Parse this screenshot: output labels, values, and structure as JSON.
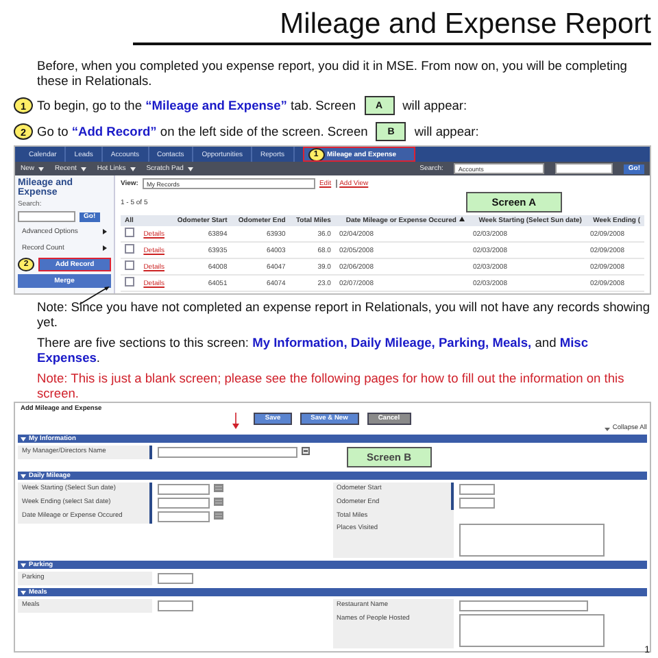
{
  "title": "Mileage and Expense Report",
  "intro": "Before, when you completed you expense report, you did it in MSE.  From now on, you will be completing these in Relationals.",
  "steps": [
    {
      "badge": "1",
      "text": "To begin, go to the **“Mileage and Expense”** tab.  Screen",
      "screen": "A",
      "after": "will appear:"
    },
    {
      "badge": "2",
      "text": "Go to **“Add Record”** on the left side of the screen.  Screen",
      "screen": "B",
      "after": "will appear:"
    }
  ],
  "screen_a": {
    "nav_tabs": [
      {
        "label": "Calendar",
        "selected": false
      },
      {
        "label": "Leads",
        "selected": false
      },
      {
        "label": "Accounts",
        "selected": false
      },
      {
        "label": "Contacts",
        "selected": false
      },
      {
        "label": "Opportunities",
        "selected": false
      },
      {
        "label": "Reports",
        "selected": false
      },
      {
        "label": "Mileage and Expense",
        "selected": true,
        "badge": "1"
      }
    ],
    "menus": [
      "New",
      "Recent",
      "Hot Links",
      "Scratch Pad"
    ],
    "search": {
      "label": "Search:",
      "scope": "Accounts",
      "button": "Go!"
    },
    "sidebar": {
      "title": "Mileage and Expense",
      "search_label": "Search:",
      "search_button": "Go!",
      "items": [
        {
          "label": "Advanced Options",
          "kind": "expander",
          "selected": false
        },
        {
          "label": "Record Count",
          "kind": "expander",
          "selected": false
        },
        {
          "label": "Add Record",
          "kind": "button",
          "selected": true,
          "badge": "2"
        },
        {
          "label": "Merge",
          "kind": "button",
          "selected": false
        }
      ]
    },
    "view": {
      "label": "View:",
      "value": "My Records",
      "links": [
        "Edit",
        "Add View"
      ]
    },
    "count": "1 - 5 of 5",
    "label": "Screen A",
    "table": {
      "columns": [
        {
          "label": "All",
          "sorted": false
        },
        {
          "label": "Odometer Start",
          "sorted": false
        },
        {
          "label": "Odometer End",
          "sorted": false
        },
        {
          "label": "Total Miles",
          "sorted": false
        },
        {
          "label": "Date Mileage or Expense Occured",
          "sorted": true
        },
        {
          "label": "Week Starting (Select Sun date)",
          "sorted": false
        },
        {
          "label": "Week Ending (",
          "sorted": false
        }
      ],
      "rows": [
        {
          "checked": false,
          "cells": [
            "Details",
            "63894",
            "63930",
            "36.0",
            "02/04/2008",
            "02/03/2008",
            "02/09/2008"
          ]
        },
        {
          "checked": false,
          "cells": [
            "Details",
            "63935",
            "64003",
            "68.0",
            "02/05/2008",
            "02/03/2008",
            "02/09/2008"
          ]
        },
        {
          "checked": false,
          "cells": [
            "Details",
            "64008",
            "64047",
            "39.0",
            "02/06/2008",
            "02/03/2008",
            "02/09/2008"
          ]
        },
        {
          "checked": false,
          "cells": [
            "Details",
            "64051",
            "64074",
            "23.0",
            "02/07/2008",
            "02/03/2008",
            "02/09/2008"
          ]
        }
      ]
    }
  },
  "notes": [
    {
      "kind": "plain",
      "text": "Note: Since you have not completed an expense report in Relationals, you will not have any records showing yet."
    },
    {
      "kind": "plain",
      "text": "There are five sections to this screen: **My Information, Daily Mileage, Parking, Meals,** and **Misc Expenses**."
    },
    {
      "kind": "warning",
      "text": "Note: This is just a blank screen; please see the following pages for how to fill out the information on this screen."
    }
  ],
  "screen_b": {
    "title": "Add Mileage and Expense",
    "buttons": [
      {
        "label": "Save",
        "kind": "primary"
      },
      {
        "label": "Save & New",
        "kind": "primary"
      },
      {
        "label": "Cancel",
        "kind": "secondary"
      }
    ],
    "collapse": "Collapse All",
    "sections": [
      {
        "title": "My Information",
        "screen_label": "Screen B",
        "left": [
          {
            "label": "My Manager/Directors Name",
            "kind": "lookup",
            "required": true
          }
        ]
      },
      {
        "title": "Daily Mileage",
        "left": [
          {
            "label": "Week Starting (Select Sun date)",
            "kind": "date",
            "required": true
          },
          {
            "label": "Week Ending (select Sat date)",
            "kind": "date",
            "required": true
          },
          {
            "label": "Date Mileage or Expense Occured",
            "kind": "date",
            "required": true
          }
        ],
        "right": [
          {
            "label": "Odometer Start",
            "kind": "text",
            "required": true
          },
          {
            "label": "Odometer End",
            "kind": "text",
            "required": true
          },
          {
            "label": "Total Miles",
            "kind": "readonly",
            "required": false
          },
          {
            "label": "Places Visited",
            "kind": "textarea",
            "required": false
          }
        ]
      },
      {
        "title": "Parking",
        "left": [
          {
            "label": "Parking",
            "kind": "text",
            "required": false
          }
        ]
      },
      {
        "title": "Meals",
        "left": [
          {
            "label": "Meals",
            "kind": "text",
            "required": false
          }
        ],
        "right": [
          {
            "label": "Restaurant Name",
            "kind": "wide",
            "required": false
          },
          {
            "label": "Names of People Hosted",
            "kind": "textarea",
            "required": false
          }
        ]
      }
    ]
  },
  "page_number": "1"
}
